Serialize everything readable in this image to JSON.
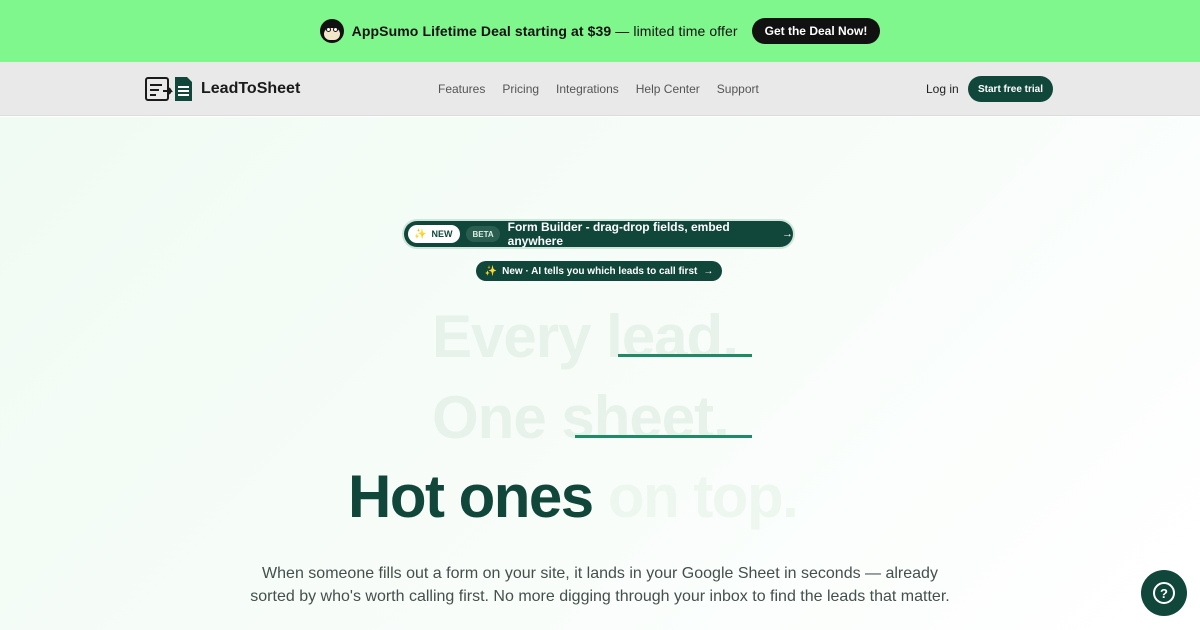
{
  "promo": {
    "text_bold": "AppSumo Lifetime Deal starting at $39",
    "text_light": " — limited time offer",
    "cta": "Get the Deal Now!"
  },
  "nav": {
    "brand": "LeadToSheet",
    "links": [
      "Features",
      "Pricing",
      "Integrations",
      "Help Center",
      "Support"
    ],
    "login": "Log in",
    "cta": "Start free trial"
  },
  "hero": {
    "pill_main": {
      "new": "NEW",
      "beta": "BETA",
      "text": "Form Builder - drag-drop fields, embed anywhere"
    },
    "pill_sub": "New · AI tells you which leads to call first",
    "ghost_line_1": "Every lead.",
    "ghost_line_2": "One sheet.",
    "headline_strong": "Hot ones",
    "headline_dim": " on top.",
    "description": "When someone fills out a form on your site, it lands in your Google Sheet in seconds — already sorted by who's worth calling first. No more digging through your inbox to find the leads that matter."
  },
  "icons": {
    "mascot": "appsumo-mascot-icon",
    "logo": "leadtosheet-logo-icon",
    "spark": "sparkle-icon",
    "arrow": "arrow-right-icon",
    "help": "question-mark-icon"
  },
  "colors": {
    "promo_bg": "#7ff78c",
    "brand_dark": "#11473a",
    "accent_underline": "#1e8a66"
  }
}
